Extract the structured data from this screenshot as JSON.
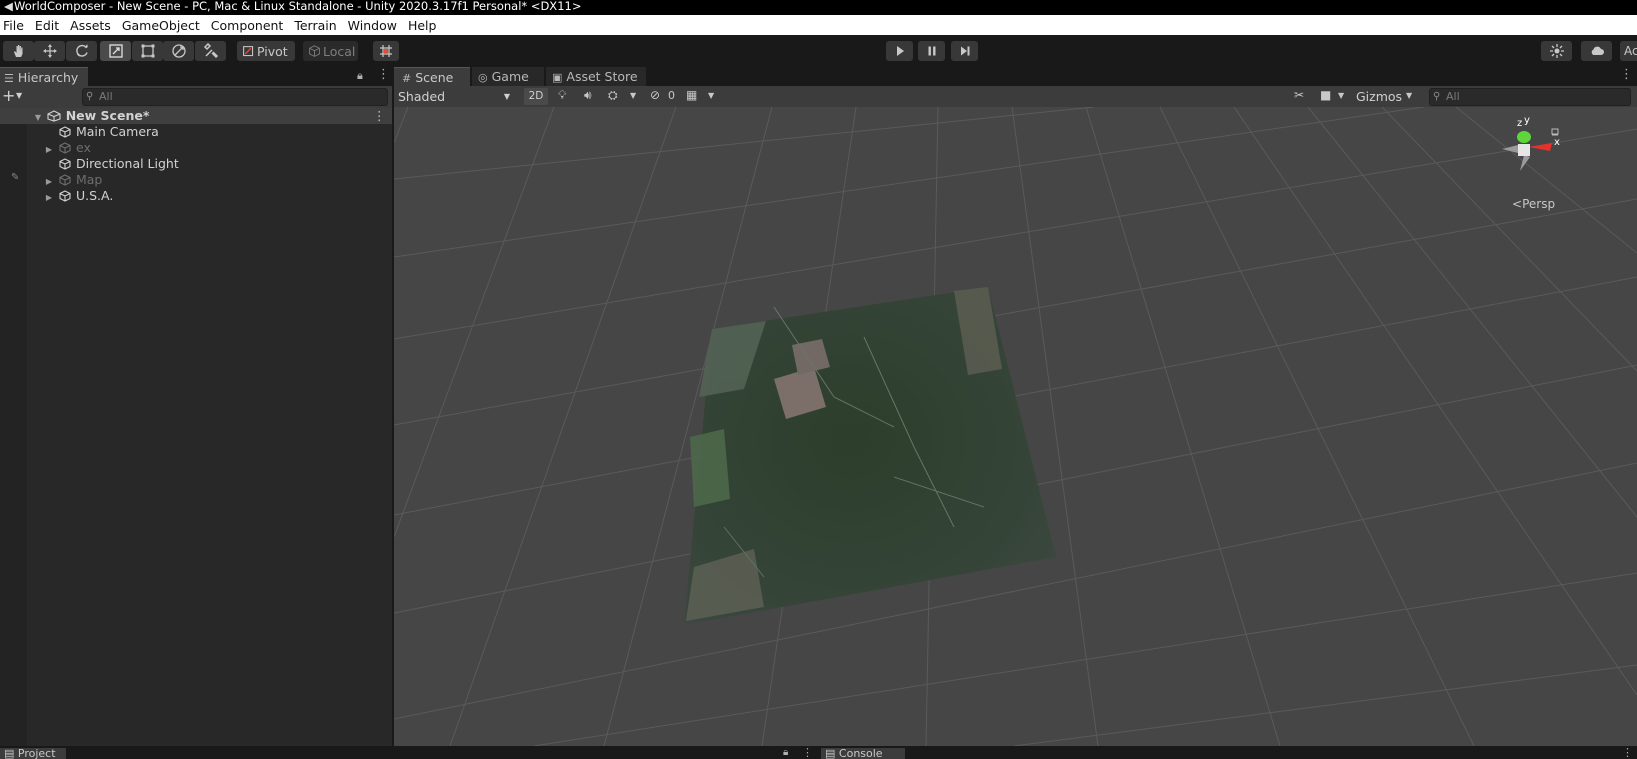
{
  "window": {
    "title": "WorldComposer - New Scene - PC, Mac & Linux Standalone - Unity 2020.3.17f1 Personal* <DX11>"
  },
  "menu": [
    "File",
    "Edit",
    "Assets",
    "GameObject",
    "Component",
    "Terrain",
    "Window",
    "Help"
  ],
  "toolbar": {
    "tools": [
      "hand-tool-icon",
      "move-tool-icon",
      "rotate-tool-icon",
      "scale-tool-icon",
      "rect-tool-icon",
      "transform-tool-icon",
      "custom-tool-icon"
    ],
    "active_tool": "scale-tool-icon",
    "pivot_label": "Pivot",
    "local_label": "Local",
    "right_truncated_label": "Ac"
  },
  "hierarchy": {
    "tab_label": "Hierarchy",
    "search_placeholder": "All",
    "scene_name": "New Scene*",
    "items": [
      {
        "label": "Main Camera",
        "expandable": false,
        "dimmed": false
      },
      {
        "label": "ex",
        "expandable": true,
        "dimmed": true
      },
      {
        "label": "Directional Light",
        "expandable": false,
        "dimmed": false
      },
      {
        "label": "Map",
        "expandable": true,
        "dimmed": true
      },
      {
        "label": "U.S.A.",
        "expandable": true,
        "dimmed": false
      }
    ]
  },
  "scene_view": {
    "tabs": [
      "Scene",
      "Game",
      "Asset Store"
    ],
    "active_tab": "Scene",
    "draw_mode": "Shaded",
    "mode_2d_label": "2D",
    "hidden_count": "0",
    "gizmos_label": "Gizmos",
    "search_placeholder": "All",
    "projection_label": "Persp",
    "axis_labels": {
      "x": "x",
      "y": "y",
      "z": "z"
    }
  },
  "bottom": {
    "project_tab": "Project",
    "console_tab": "Console"
  },
  "colors": {
    "background": "#191919",
    "panel": "#282828",
    "viewport": "#464646",
    "gizmo_x": "#e8312a",
    "gizmo_y": "#5ed53b"
  }
}
